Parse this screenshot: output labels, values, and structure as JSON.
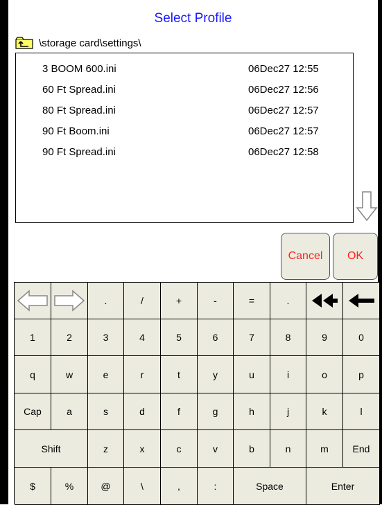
{
  "title": "Select Profile",
  "path": "\\storage card\\settings\\",
  "files": [
    {
      "name": "3 BOOM 600.ini",
      "date": "06Dec27 12:55"
    },
    {
      "name": "60 Ft Spread.ini",
      "date": "06Dec27 12:56"
    },
    {
      "name": "80 Ft Spread.ini",
      "date": "06Dec27 12:57"
    },
    {
      "name": "90 Ft Boom.ini",
      "date": "06Dec27 12:57"
    },
    {
      "name": "90 Ft Spread.ini",
      "date": "06Dec27 12:58"
    }
  ],
  "buttons": {
    "cancel": "Cancel",
    "ok": "OK"
  },
  "icons": {
    "folder": "folder-up-icon",
    "scroll": "scroll-down-arrow-icon",
    "left": "cursor-left-arrow-icon",
    "right": "cursor-right-arrow-icon",
    "clear": "clear-double-arrow-icon",
    "backspace": "backspace-arrow-icon"
  },
  "keyboard": {
    "row1": [
      ".",
      "/",
      "+",
      "-",
      "=",
      "."
    ],
    "row2": [
      "1",
      "2",
      "3",
      "4",
      "5",
      "6",
      "7",
      "8",
      "9",
      "0"
    ],
    "row3": [
      "q",
      "w",
      "e",
      "r",
      "t",
      "y",
      "u",
      "i",
      "o",
      "p"
    ],
    "row4": [
      "Cap",
      "a",
      "s",
      "d",
      "f",
      "g",
      "h",
      "j",
      "k",
      "l"
    ],
    "row5": [
      "Shift",
      "z",
      "x",
      "c",
      "v",
      "b",
      "n",
      "m",
      "End"
    ],
    "row6": [
      "$",
      "%",
      "@",
      "\\",
      ",",
      ":",
      "Space",
      "Enter"
    ]
  },
  "colors": {
    "title": "#1a1aff",
    "action_text": "#ff2020",
    "keyboard_bg": "#ecebdf",
    "frame": "#000000"
  }
}
